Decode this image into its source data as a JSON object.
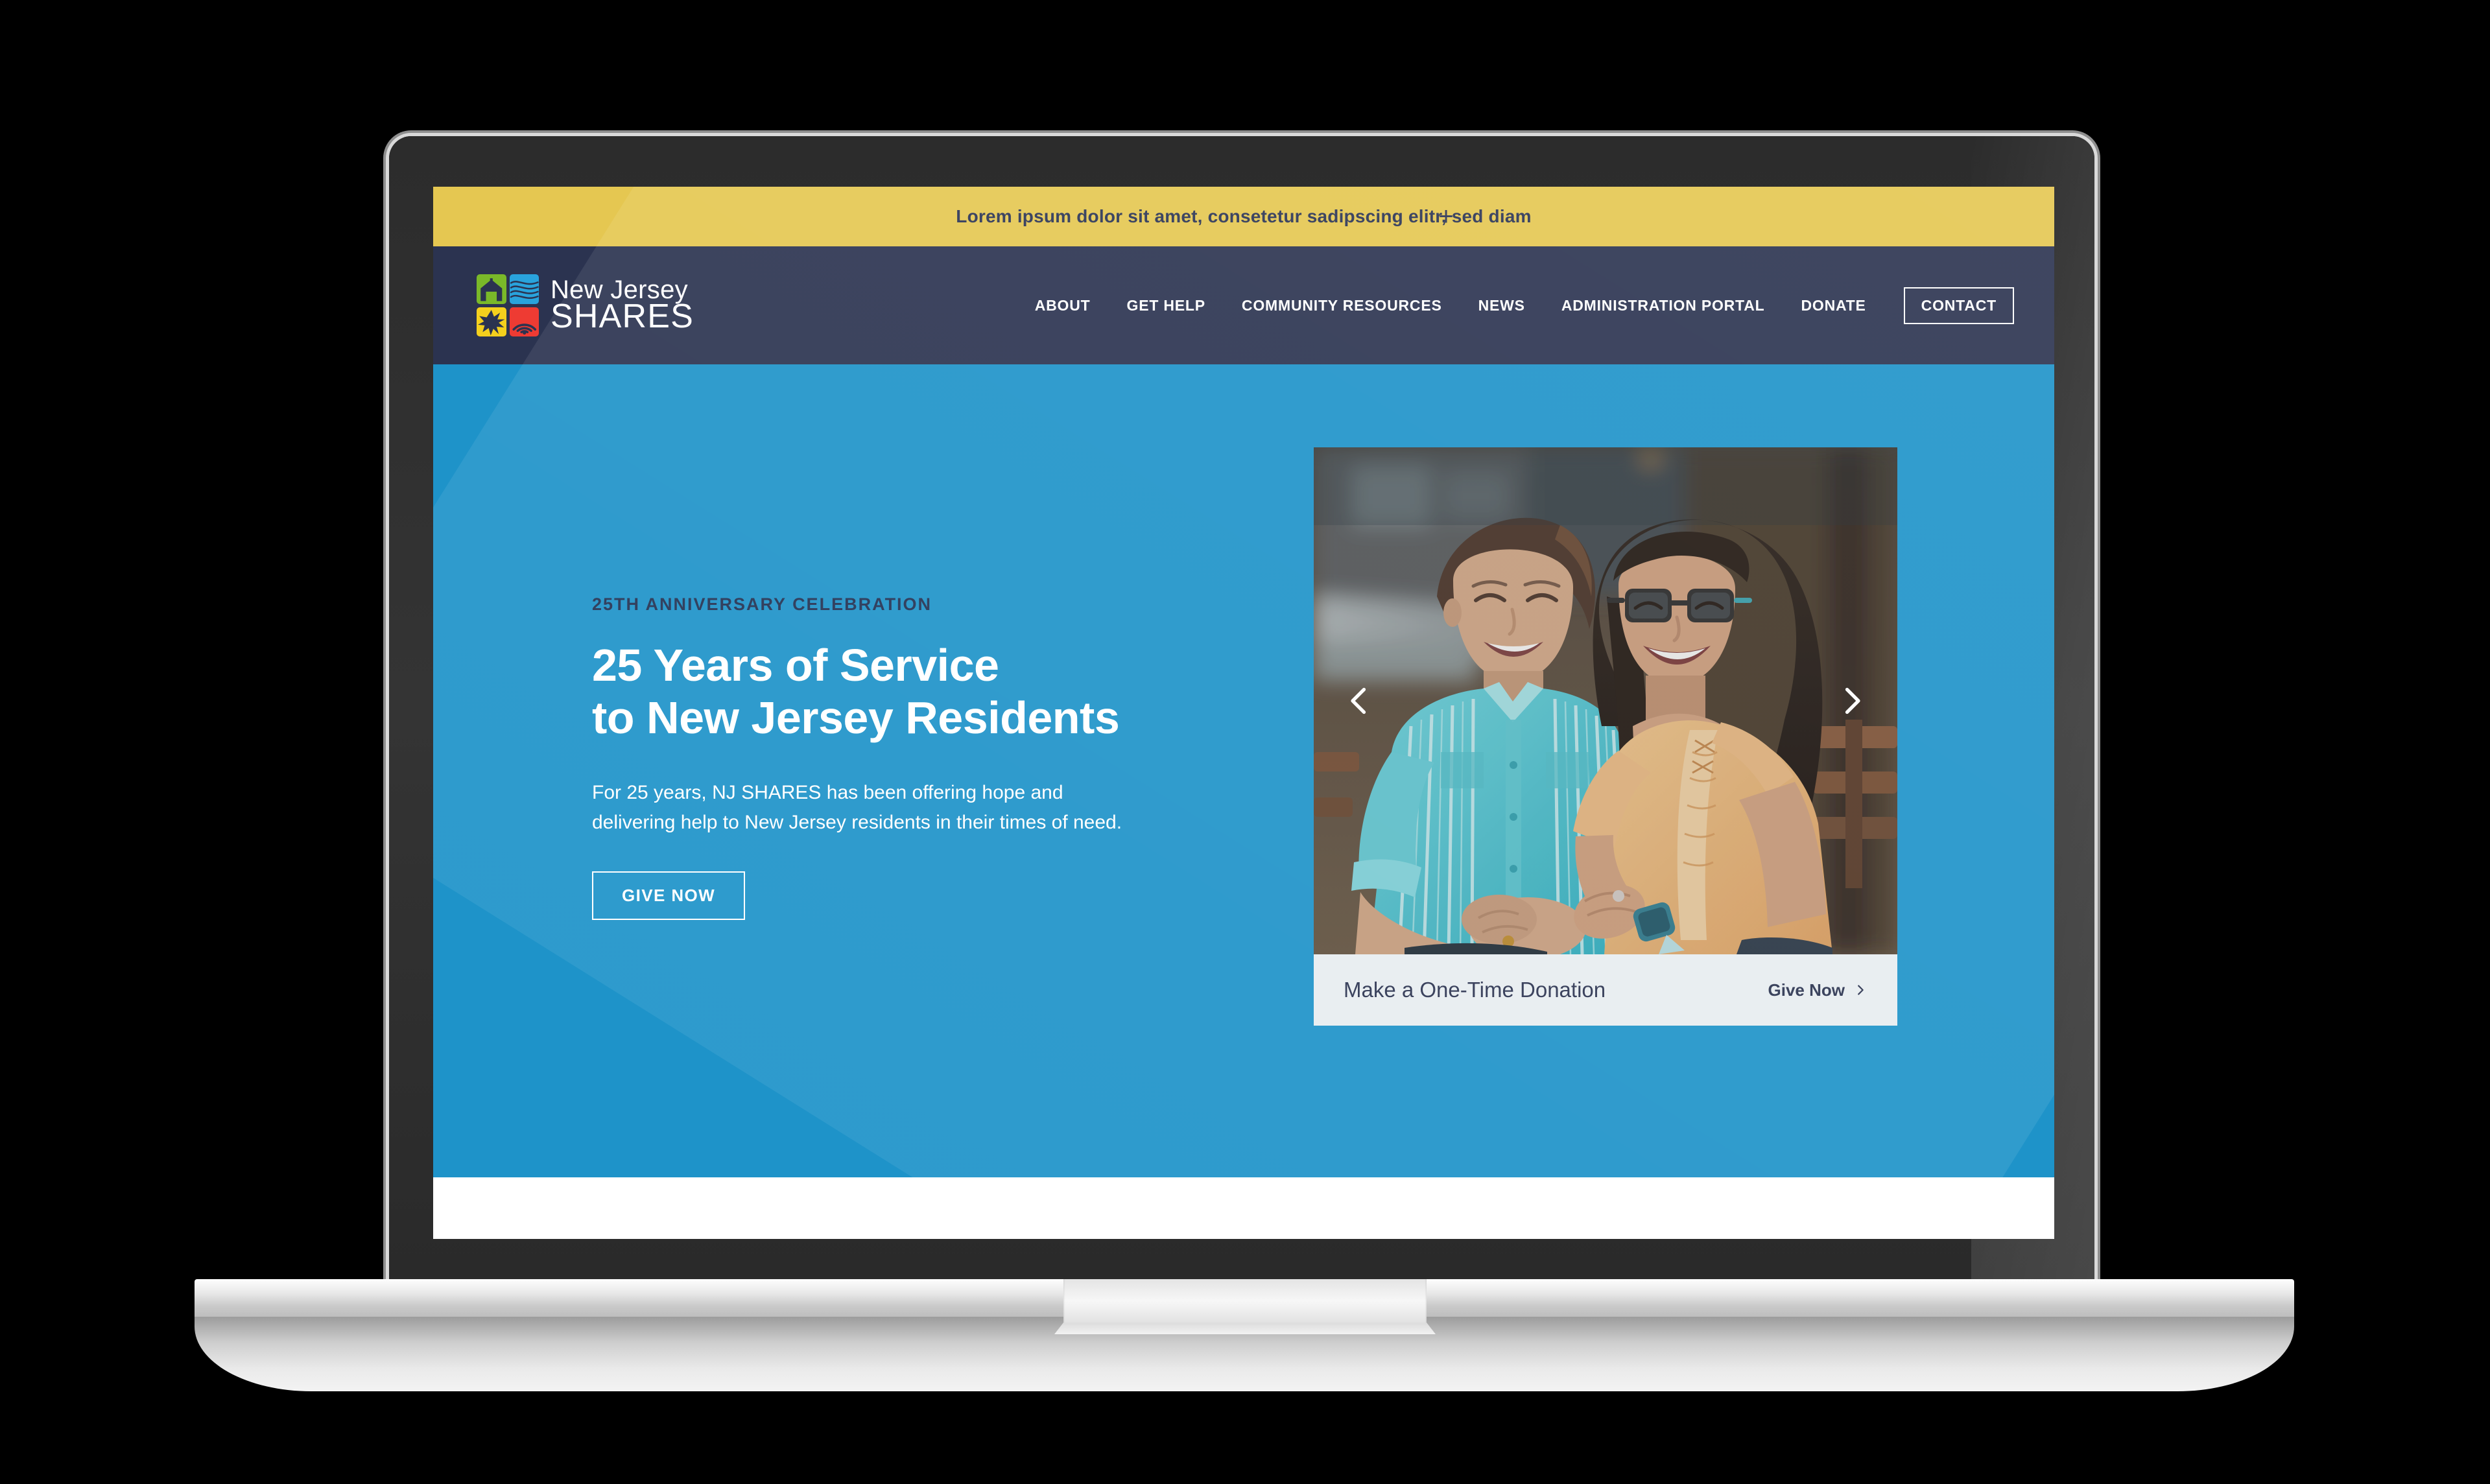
{
  "announcement": {
    "text": "Lorem ipsum dolor sit amet, consetetur sadipscing elitr, sed diam",
    "expand_icon": "plus-icon",
    "background": "#e5c751",
    "text_color": "#2b3454"
  },
  "header": {
    "background": "#2b3350",
    "logo": {
      "line1": "New Jersey",
      "line2": "SHARES",
      "tiles": [
        {
          "name": "house-icon",
          "color": "#7ab929"
        },
        {
          "name": "waves-icon",
          "color": "#29a3dc"
        },
        {
          "name": "sunburst-icon",
          "color": "#f4d01d"
        },
        {
          "name": "signal-icon",
          "color": "#ee3b33"
        }
      ]
    },
    "nav": [
      {
        "label": "ABOUT",
        "name": "nav-item-about"
      },
      {
        "label": "GET HELP",
        "name": "nav-item-get-help"
      },
      {
        "label": "COMMUNITY RESOURCES",
        "name": "nav-item-community-resources"
      },
      {
        "label": "NEWS",
        "name": "nav-item-news"
      },
      {
        "label": "ADMINISTRATION PORTAL",
        "name": "nav-item-administration-portal"
      },
      {
        "label": "DONATE",
        "name": "nav-item-donate"
      }
    ],
    "contact_label": "CONTACT"
  },
  "hero": {
    "background": "#1e93c9",
    "eyebrow": "25TH ANNIVERSARY CELEBRATION",
    "heading_line1": "25 Years of Service",
    "heading_line2": "to New Jersey Residents",
    "body": "For 25 years, NJ SHARES has been offering hope and delivering help to New Jersey residents in their times of need.",
    "cta_label": "GIVE NOW"
  },
  "donation_card": {
    "photo_alt": "Two women laughing together on a park bench",
    "prev_icon": "chevron-left-icon",
    "next_icon": "chevron-right-icon",
    "title": "Make a One-Time Donation",
    "link_label": "Give Now",
    "link_icon": "chevron-right-icon",
    "bar_background": "#e7edf0"
  }
}
